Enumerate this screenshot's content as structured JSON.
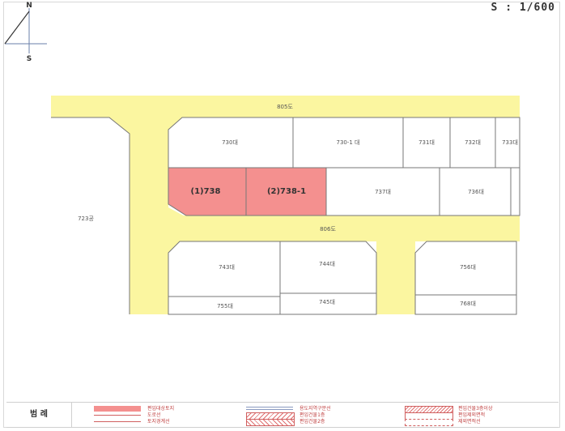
{
  "scale": "S : 1/600",
  "north_label": "N",
  "south_label": "S",
  "roads": {
    "north_road": "805도",
    "middle_road": "806도"
  },
  "parcels": {
    "p730": "730대",
    "p730_1": "730-1 대",
    "p731": "731대",
    "p732": "732대",
    "p733": "733대",
    "p738": "(1)738",
    "p738_1": "(2)738-1",
    "p737": "737대",
    "p736": "736대",
    "p723": "723공",
    "p743": "743대",
    "p744": "744대",
    "p756": "756대",
    "p755": "755대",
    "p745": "745대",
    "p768": "768대"
  },
  "legend": {
    "title": "범  례",
    "items": [
      "편입대상토지",
      "도로선",
      "토지경계선",
      "용도지역구분선",
      "편입건물1층",
      "편입건물2층",
      "편입건물3층이상",
      "편입제외면적",
      "제외면적선"
    ]
  },
  "colors": {
    "road": "#fbf6a0",
    "selected": "#f4908f",
    "border": "#777777"
  }
}
